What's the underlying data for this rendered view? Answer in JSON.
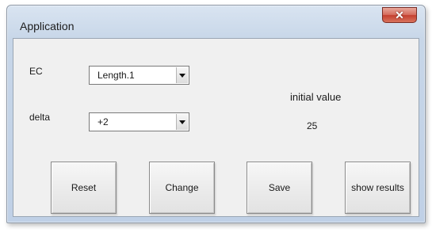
{
  "window": {
    "title": "Application",
    "close_symbol": "✕",
    "close_icon": "close-icon"
  },
  "form": {
    "ec_label": "EC",
    "ec_value": "Length.1",
    "delta_label": "delta",
    "delta_value": "+2",
    "initial_label": "initial value",
    "initial_number": "25"
  },
  "buttons": {
    "reset": "Reset",
    "change": "Change",
    "save": "Save",
    "show_results": "show results"
  },
  "colors": {
    "frame": "#c7d6e8",
    "client": "#f0f0f0",
    "close_button": "#c43f2f"
  }
}
